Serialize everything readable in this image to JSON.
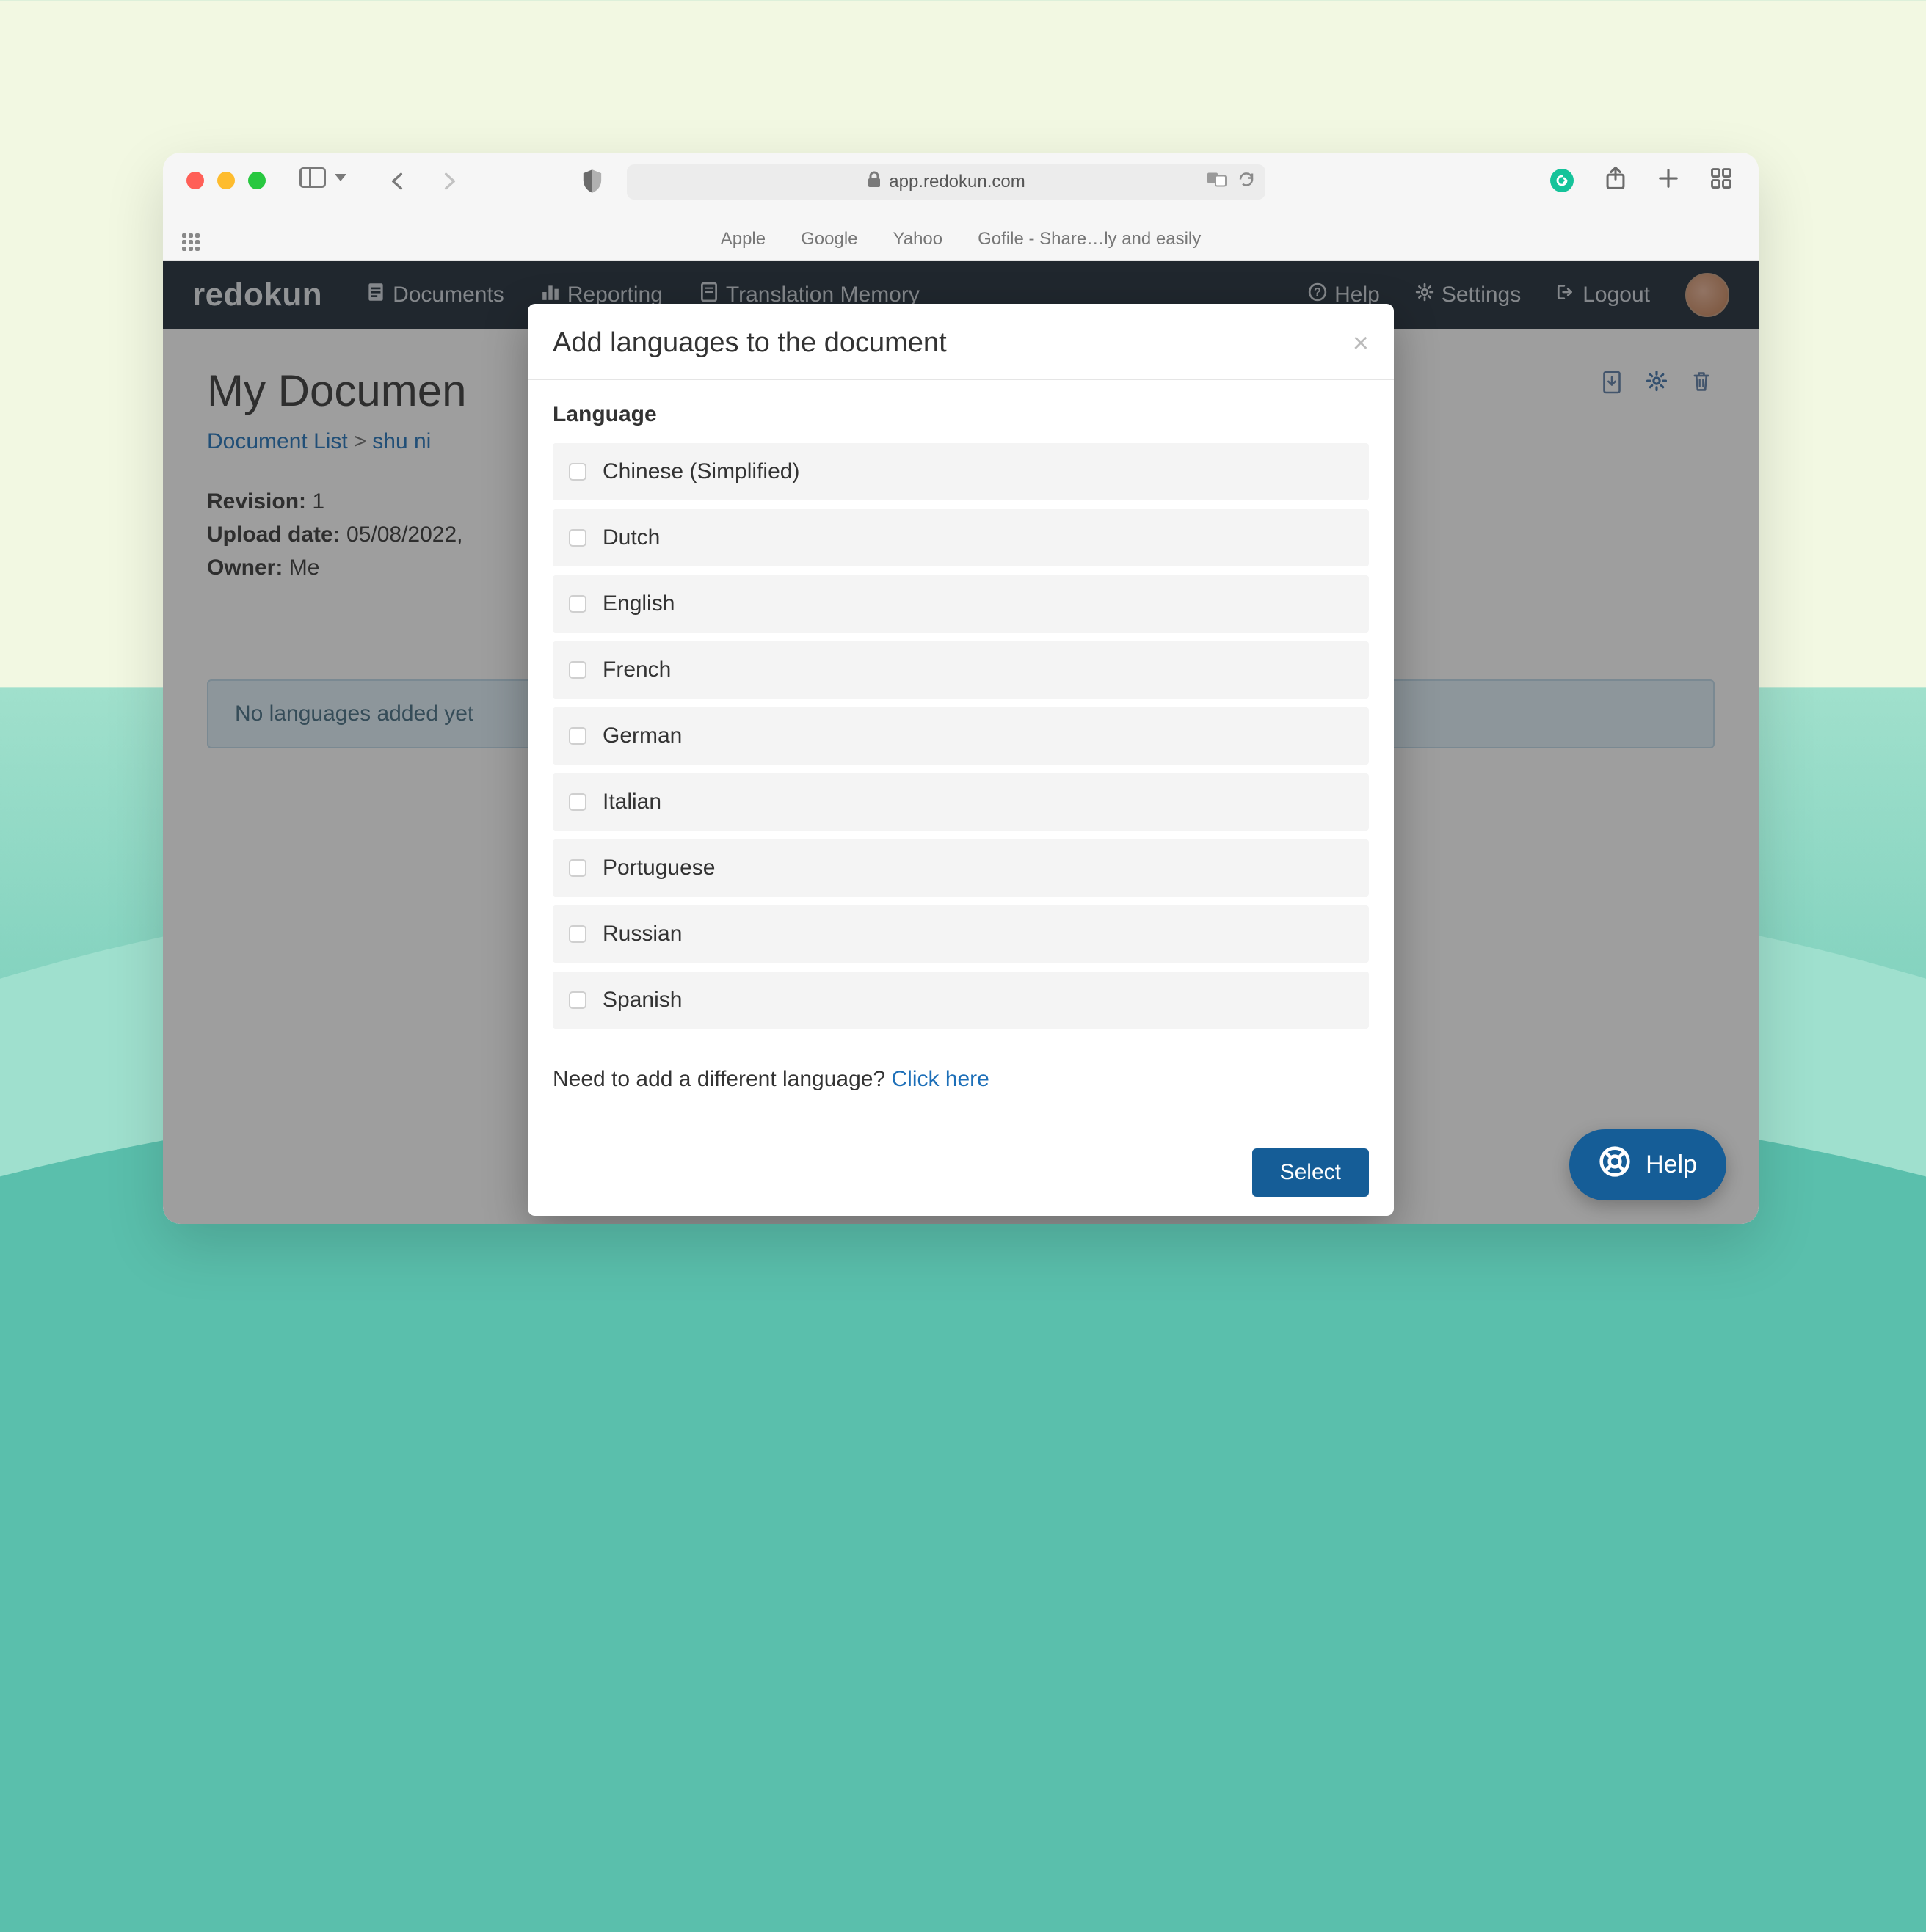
{
  "browser": {
    "address": "app.redokun.com",
    "bookmarks": [
      "Apple",
      "Google",
      "Yahoo",
      "Gofile - Share…ly and easily"
    ]
  },
  "nav": {
    "logo": "redokun",
    "documents": "Documents",
    "reporting": "Reporting",
    "translation_memory": "Translation Memory",
    "help": "Help",
    "settings": "Settings",
    "logout": "Logout"
  },
  "page": {
    "title": "My Documen",
    "breadcrumb_root": "Document List",
    "breadcrumb_current": "shu ni",
    "revision_label": "Revision:",
    "revision_value": "1",
    "upload_label": "Upload date:",
    "upload_value": "05/08/2022,",
    "owner_label": "Owner:",
    "owner_value": "Me",
    "alert_text": "No languages added yet"
  },
  "modal": {
    "title": "Add languages to the document",
    "close": "×",
    "language_label": "Language",
    "languages": [
      "Chinese (Simplified)",
      "Dutch",
      "English",
      "French",
      "German",
      "Italian",
      "Portuguese",
      "Russian",
      "Spanish"
    ],
    "note_text": "Need to add a different language? ",
    "note_link": "Click here",
    "select_btn": "Select"
  },
  "help_widget": {
    "label": "Help"
  }
}
